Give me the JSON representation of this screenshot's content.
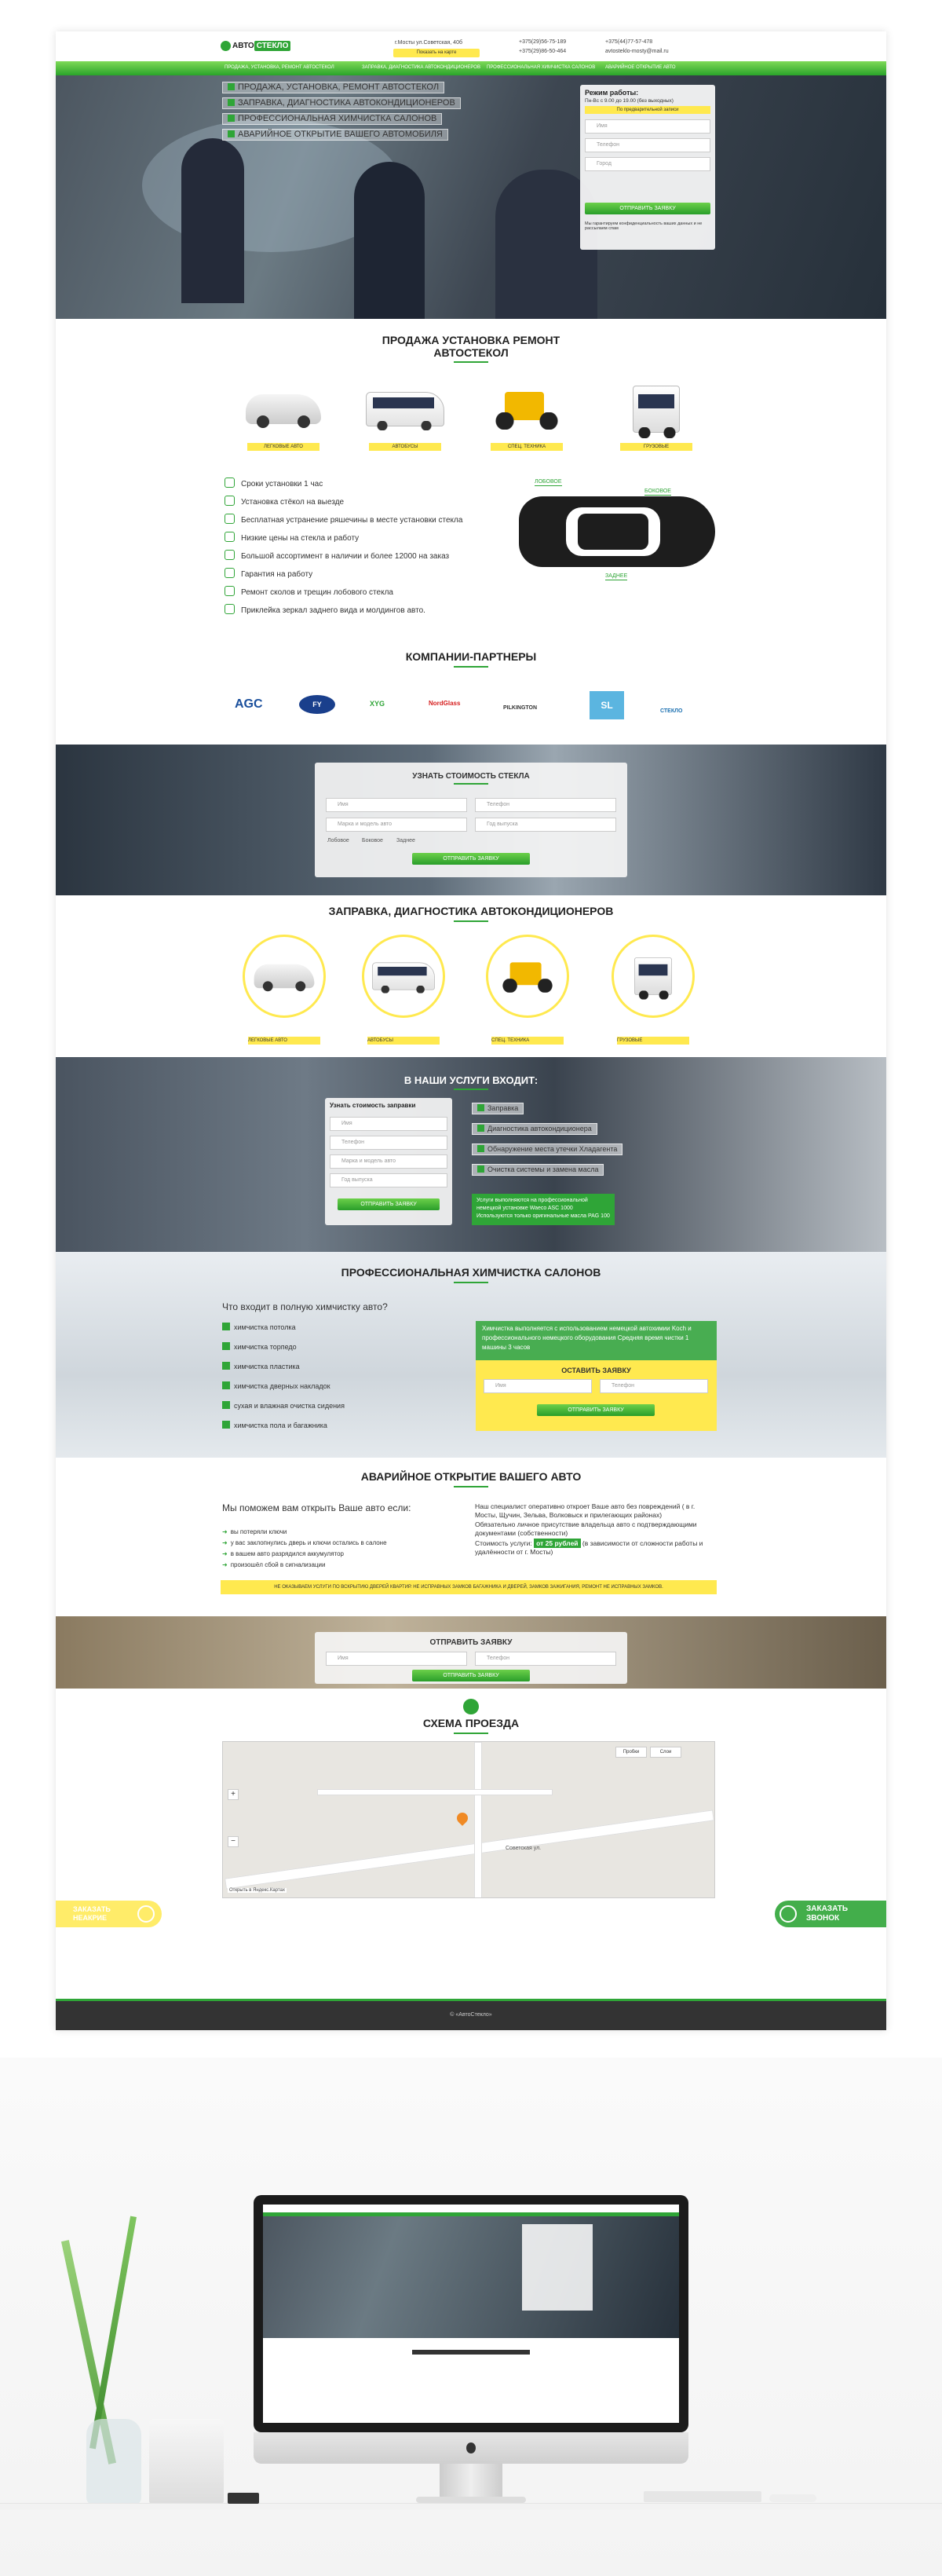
{
  "header": {
    "logo_a": "АВТО",
    "logo_b": "СТЕКЛО",
    "address": "г.Мосты ул.Советская, 40б",
    "callback_btn": "Показать на карте",
    "phone1": "+375(29)56-75-189",
    "phone2": "+375(29)86-50-464",
    "phone3": "+375(44)77-57-478",
    "email": "avtosteklo-mosty@mail.ru"
  },
  "nav": [
    "ПРОДАЖА, УСТАНОВКА, РЕМОНТ АВТОСТЕКОЛ",
    "ЗАПРАВКА, ДИАГНОСТИКА АВТОКОНДИЦИОНЕРОВ",
    "ПРОФЕССИОНАЛЬНАЯ ХИМЧИСТКА САЛОНОВ",
    "АВАРИЙНОЕ ОТКРЫТИЕ АВТО"
  ],
  "hero": {
    "bullets": [
      "ПРОДАЖА, УСТАНОВКА, РЕМОНТ АВТОСТЕКОЛ",
      "ЗАПРАВКА, ДИАГНОСТИКА АВТОКОНДИЦИОНЕРОВ",
      "ПРОФЕССИОНАЛЬНАЯ ХИМЧИСТКА САЛОНОВ",
      "АВАРИЙНОЕ ОТКРЫТИЕ ВАШЕГО АВТОМОБИЛЯ"
    ],
    "form_title": "Режим работы:",
    "form_sub": "Пн-Вс с 9.00 до 19.00 (без выходных)",
    "form_yellow": "По предварительной записи",
    "name_ph": "Имя",
    "phone_ph": "Телефон",
    "car_ph": "Город",
    "submit": "ОТПРАВИТЬ ЗАЯВКУ",
    "note": "Мы гарантируем конфиденциальность ваших данных и не рассылаем спам"
  },
  "s1": {
    "title_l1": "ПРОДАЖА УСТАНОВКА РЕМОНТ",
    "title_l2": "АВТОСТЕКОЛ",
    "vehicles": [
      "ЛЕГКОВЫЕ АВТО",
      "АВТОБУСЫ",
      "СПЕЦ. ТЕХНИКА",
      "ГРУЗОВЫЕ"
    ],
    "features": [
      "Сроки установки 1 час",
      "Установка стёкол на выезде",
      "Бесплатная устранение ряшечины в месте установки стекла",
      "Низкие цены на стекла и работу",
      "Большой ассортимент в наличии и более 12000 на заказ",
      "Гарантия на работу",
      "Ремонт сколов и трещин лобового стекла",
      "Приклейка зеркал заднего вида и молдингов авто."
    ],
    "car_labels": [
      "ЛОБОВОЕ",
      "БОКОВОЕ",
      "ЗАДНЕЕ"
    ]
  },
  "partners": {
    "title": "КОМПАНИИ-ПАРТНЕРЫ",
    "logos": [
      "AGC",
      "FY",
      "XYG",
      "NordGlass",
      "PILKINGTON",
      "SL",
      "СТЕКЛО"
    ]
  },
  "s2": {
    "title": "УЗНАТЬ СТОИМОСТЬ СТЕКЛА",
    "name": "Имя",
    "phone": "Телефон",
    "car": "Марка и модель авто",
    "year": "Год выпуска",
    "opts": [
      "Лобовое",
      "Боковое",
      "Заднее"
    ],
    "submit": "ОТПРАВИТЬ ЗАЯВКУ"
  },
  "s3": {
    "title": "ЗАПРАВКА, ДИАГНОСТИКА АВТОКОНДИЦИОНЕРОВ",
    "vehicles": [
      "ЛЕГКОВЫЕ АВТО",
      "АВТОБУСЫ",
      "СПЕЦ. ТЕХНИКА",
      "ГРУЗОВЫЕ"
    ]
  },
  "s4": {
    "title": "В НАШИ УСЛУГИ ВХОДИТ:",
    "form_title": "Узнать стоимость заправки",
    "name": "Имя",
    "phone": "Телефон",
    "car": "Марка и модель авто",
    "year": "Год выпуска",
    "submit": "ОТПРАВИТЬ ЗАЯВКУ",
    "items": [
      "Заправка",
      "Диагностика автокондиционера",
      "Обнаружение места утечки Хладагента",
      "Очистка системы и замена масла"
    ],
    "green": "Услуги выполняются на профессиональной немецкой установке Waeco ASC 1000 Используются только оригинальные масла PAG 100"
  },
  "s5": {
    "title": "ПРОФЕССИОНАЛЬНАЯ ХИМЧИСТКА САЛОНОВ",
    "q": "Что входит в полную химчистку авто?",
    "items": [
      "химчистка потолка",
      "химчистка торпедо",
      "химчистка пластика",
      "химчистка дверных накладок",
      "сухая и влажная очистка сидения",
      "химчистка пола и багажника"
    ],
    "green": "Химчистка выполняется с использованием немецкой автохимии Koch и профессионального немецкого оборудования Средняя время чистки 1 машины 3 часов",
    "form_title": "ОСТАВИТЬ ЗАЯВКУ",
    "name": "Имя",
    "phone": "Телефон",
    "submit": "ОТПРАВИТЬ ЗАЯВКУ"
  },
  "s6": {
    "title": "АВАРИЙНОЕ ОТКРЫТИЕ ВАШЕГО АВТО",
    "q": "Мы поможем вам открыть Ваше авто если:",
    "items": [
      "вы потеряли ключи",
      "у вас заклопнулись дверь и ключи остались в салоне",
      "в вашем авто разрядился аккумулятор",
      "произошёл сбой в сигнализации"
    ],
    "p1": "Наш специалист оперативно откроет Ваше авто без повреждений ( в г. Мосты, Щучин, Зельва, Волковыск и прилегающих районах)",
    "p2": "Обязательно личное присутствие владельца авто с подтверждающими документами (собственности)",
    "price_pre": "Стоимость услуги:",
    "price": "от 25 рублей",
    "price_post": "(в зависимости от сложности работы и удалённости от г. Мосты)",
    "yellow": "НЕ ОКАЗЫВАЕМ УСЛУГИ ПО ВСКРЫТИЮ ДВЕРЕЙ КВАРТИР. НЕ ИСПРАВНЫХ ЗАМКОВ БАГАЖНИКА И ДВЕРЕЙ, ЗАМКОВ ЗАЖИГАНИЯ, РЕМОНТ НЕ ИСПРАВНЫХ ЗАМКОВ."
  },
  "s7": {
    "title": "ОТПРАВИТЬ ЗАЯВКУ",
    "name": "Имя",
    "phone": "Телефон",
    "submit": "ОТПРАВИТЬ ЗАЯВКУ"
  },
  "s8": {
    "title": "СХЕМА ПРОЕЗДА",
    "street": "Советская ул.",
    "btn_traffic": "Пробки",
    "btn_layers": "Слои",
    "yandex": "Открыть в Яндекс.Картах"
  },
  "float": {
    "left": "ЗАКАЗАТЬ НЕАКРИЕ",
    "right_l1": "ЗАКАЗАТЬ",
    "right_l2": "ЗВОНОК"
  },
  "footer": "© «АвтоСтекло»",
  "colors": {
    "green": "#2fa537",
    "yellow": "#ffe94f",
    "dark": "#333333"
  }
}
